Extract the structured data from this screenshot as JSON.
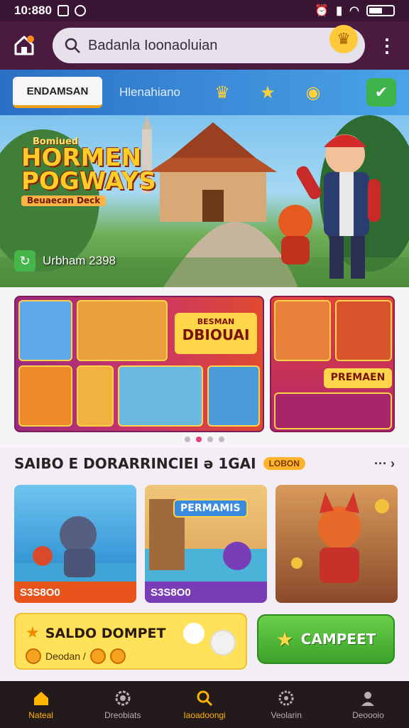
{
  "status": {
    "time": "10:880"
  },
  "header": {
    "search_text": "Badanla Ioonaoluian"
  },
  "tabs": {
    "active_label": "ENDAMSAN",
    "second_label": "Hlenahiano"
  },
  "hero": {
    "pre_title": "Bomiued",
    "title_line1": "HORMEN",
    "title_line2": "POGWAYS",
    "subtitle": "Beuaecan Deck",
    "pill_text": "Urbham 2398"
  },
  "promo": {
    "big_label": "DBIOUAI",
    "big_pre": "BESMAN",
    "small_label": "PREMAEN"
  },
  "section": {
    "title": "SAIBO E DORARRINCIEI ə 1GAI",
    "tag": "LOBON"
  },
  "games": [
    {
      "label": "S3S8O0",
      "accent": "#e8531b"
    },
    {
      "label": "S3S8O0",
      "accent": "#7a3db8",
      "banner": "PERMAMIS"
    },
    {
      "label": "",
      "accent": "#a8342a"
    }
  ],
  "wallet": {
    "title": "SALDO DOMPET",
    "sub": "Deodan /"
  },
  "camp_button": {
    "label": "CAMPEET"
  },
  "nav": [
    {
      "label": "Nateal",
      "icon": "home-icon"
    },
    {
      "label": "Dreobiats",
      "icon": "gear-badge-icon"
    },
    {
      "label": "Iaoadoongi",
      "icon": "search-icon"
    },
    {
      "label": "Veolarin",
      "icon": "settings-icon"
    },
    {
      "label": "Deoooio",
      "icon": "profile-icon"
    }
  ],
  "colors": {
    "header_bg": "#4a1a40",
    "tabs_bg": "#2a6fc4",
    "accent_green": "#3ba12a",
    "nav_active": "#ffb400"
  }
}
